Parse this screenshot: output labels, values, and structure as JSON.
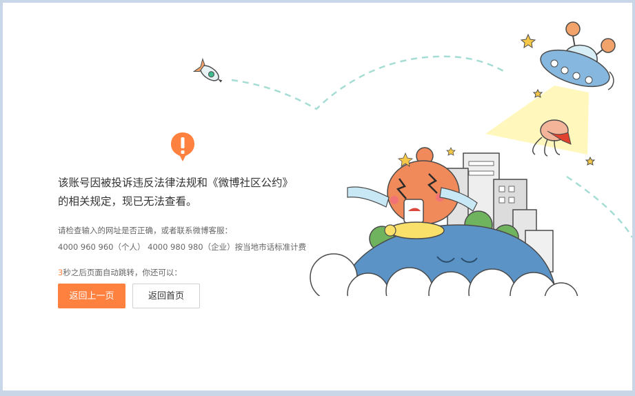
{
  "notice": {
    "line1": "该账号因被投诉违反法律法规和《微博社区公约》",
    "line2": "的相关规定，现已无法查看。"
  },
  "contact": {
    "line1": "请检查输入的网址是否正确，或者联系微博客服：",
    "line2": "4000 960 960（个人） 4000 980 980（企业）按当地市话标准计费"
  },
  "redirect": {
    "count": "3",
    "text": "秒之后页面自动跳转，你还可以："
  },
  "buttons": {
    "back_label": "返回上一页",
    "home_label": "返回首页"
  },
  "icons": {
    "alert": "exclamation-icon"
  },
  "colors": {
    "accent": "#ff8140",
    "ground": "#5b93c7",
    "dash": "#9fdcd2"
  }
}
